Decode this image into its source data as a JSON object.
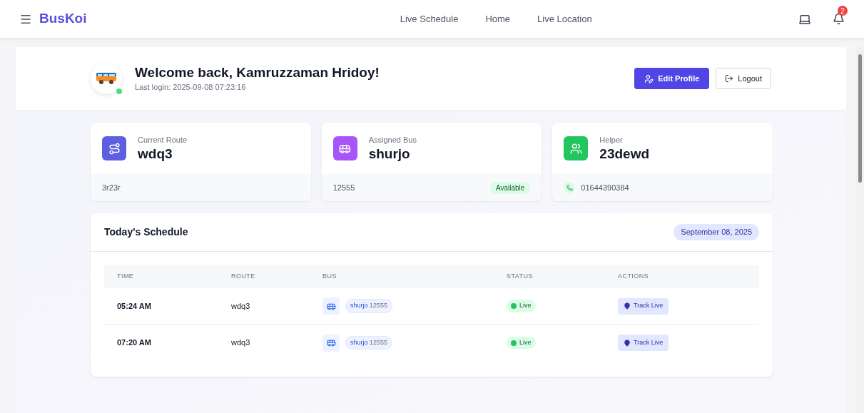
{
  "nav": {
    "brand": "BusKoi",
    "links": [
      "Live Schedule",
      "Home",
      "Live Location"
    ],
    "notification_count": "2"
  },
  "welcome": {
    "title": "Welcome back, Kamruzzaman Hridoy!",
    "last_login": "Last login: 2025-09-08 07:23:16",
    "online": true,
    "buttons": [
      {
        "label": "Edit Profile",
        "kind": "primary"
      },
      {
        "label": "Logout",
        "kind": "outline"
      }
    ]
  },
  "cards": [
    {
      "kind": "route",
      "label": "Current Route",
      "value": "wdq3",
      "footer": "3r23r"
    },
    {
      "kind": "bus",
      "label": "Assigned Bus",
      "value": "shurjo",
      "footer": "12555",
      "badge": "Available"
    },
    {
      "kind": "helper",
      "label": "Helper",
      "value": "23dewd",
      "footer": "01644390384"
    }
  ],
  "schedule": {
    "title": "Today's Schedule",
    "date": "September 08, 2025",
    "columns": [
      "TIME",
      "ROUTE",
      "BUS",
      "STATUS",
      "ACTIONS"
    ],
    "rows": [
      {
        "time": "05:24 AM",
        "route": "wdq3",
        "bus_name": "shurjo",
        "bus_number": "12555",
        "status": "Live",
        "kind": "live",
        "action": "Track Live"
      },
      {
        "time": "07:20 AM",
        "route": "wdq3",
        "bus_name": "shurjo",
        "bus_number": "12555",
        "status": "Live",
        "kind": "live",
        "action": "Track Live"
      }
    ]
  }
}
